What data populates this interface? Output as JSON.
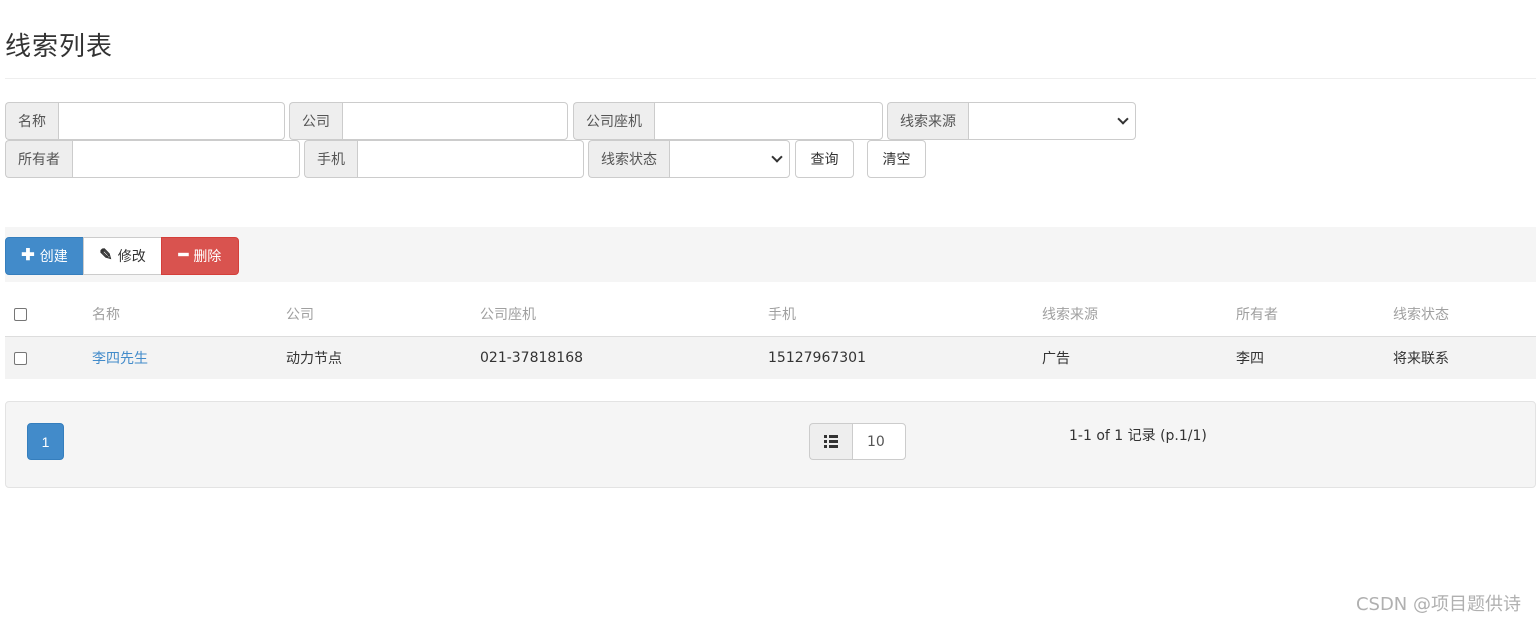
{
  "page": {
    "title": "线索列表"
  },
  "search": {
    "name_label": "名称",
    "company_label": "公司",
    "phone_label": "公司座机",
    "source_label": "线索来源",
    "owner_label": "所有者",
    "mobile_label": "手机",
    "state_label": "线索状态",
    "name_value": "",
    "company_value": "",
    "phone_value": "",
    "owner_value": "",
    "mobile_value": "",
    "source_selected": "",
    "state_selected": "",
    "query_label": "查询",
    "clear_label": "清空"
  },
  "toolbar": {
    "create_label": "创建",
    "create_icon": "plus-icon",
    "edit_label": "修改",
    "edit_icon": "pencil-icon",
    "delete_label": "删除",
    "delete_icon": "minus-icon",
    "create_color": "#428bca",
    "delete_color": "#d9534f"
  },
  "table": {
    "columns": [
      "名称",
      "公司",
      "公司座机",
      "手机",
      "线索来源",
      "所有者",
      "线索状态"
    ],
    "rows": [
      {
        "name": "李四先生",
        "company": "动力节点",
        "phone": "021-37818168",
        "mobile": "15127967301",
        "source": "广告",
        "owner": "李四",
        "state": "将来联系"
      }
    ]
  },
  "pagination": {
    "current_page": "1",
    "page_size": "10",
    "page_size_icon": "list-icon",
    "record_info": "1-1 of 1 记录 (p.1/1)"
  },
  "watermark": "CSDN @项目题供诗"
}
